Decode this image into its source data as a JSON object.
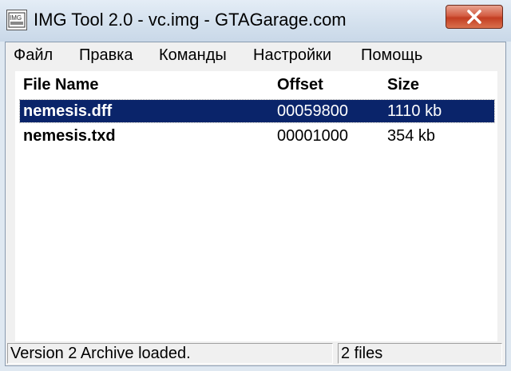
{
  "window": {
    "title": "IMG Tool 2.0 - vc.img - GTAGarage.com"
  },
  "menu": [
    {
      "label": "Файл"
    },
    {
      "label": "Правка"
    },
    {
      "label": "Команды"
    },
    {
      "label": "Настройки"
    },
    {
      "label": "Помощь"
    }
  ],
  "list": {
    "columns": [
      "File Name",
      "Offset",
      "Size"
    ],
    "rows": [
      {
        "name": "nemesis.dff",
        "offset": "00059800",
        "size": "1110 kb",
        "selected": true
      },
      {
        "name": "nemesis.txd",
        "offset": "00001000",
        "size": "354 kb",
        "selected": false
      }
    ]
  },
  "status": {
    "message": "Version 2 Archive loaded.",
    "count": "2 files"
  },
  "colors": {
    "selection": "#0a246a",
    "close_button": "#c33d22"
  }
}
